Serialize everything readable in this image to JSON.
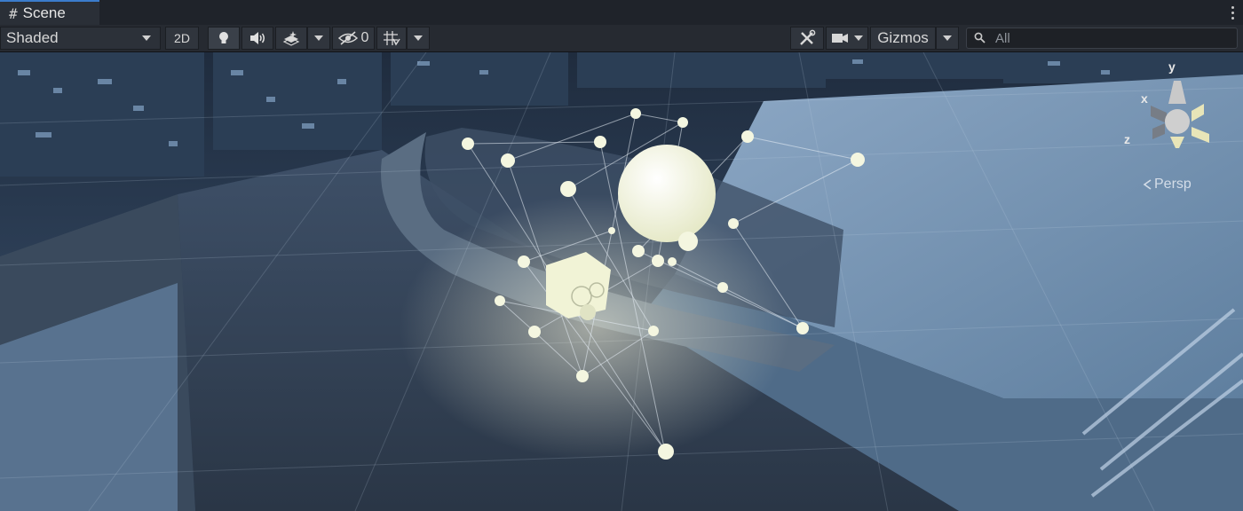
{
  "tab": {
    "icon": "hash-grid-icon",
    "title": "Scene"
  },
  "toolbar": {
    "shading_mode": "Shaded",
    "toggle_2d": "2D",
    "hidden_count": "0",
    "gizmos_label": "Gizmos",
    "search_placeholder": "All"
  },
  "gizmo": {
    "x_label": "x",
    "y_label": "y",
    "z_label": "z",
    "projection": "Persp"
  },
  "colors": {
    "accent": "#3b7ccc",
    "probe": "#f4f6e0",
    "viewport_tint": "#4a6c93"
  }
}
